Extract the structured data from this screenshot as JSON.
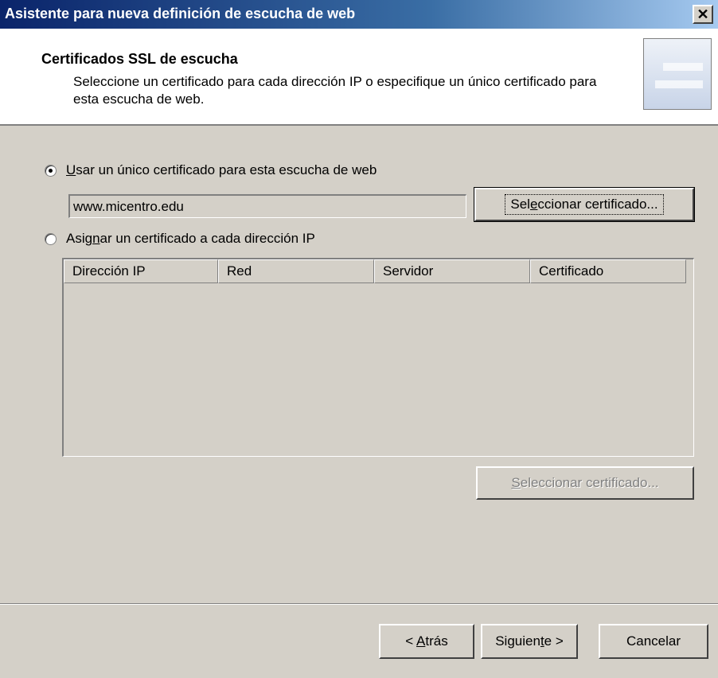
{
  "window": {
    "title": "Asistente para nueva definición de escucha de web"
  },
  "header": {
    "title": "Certificados SSL de escucha",
    "description": "Seleccione un certificado para cada dirección IP o especifique un único certificado para esta escucha de web."
  },
  "options": {
    "single": {
      "label_prefix": "U",
      "label_rest": "sar un único certificado para esta escucha de web",
      "selected": true
    },
    "per_ip": {
      "label_a": "Asig",
      "label_u": "n",
      "label_b": "ar un certificado a cada dirección IP",
      "selected": false
    }
  },
  "certificate_field": {
    "value": "www.micentro.edu"
  },
  "buttons": {
    "select_cert_a": "Sel",
    "select_cert_u": "e",
    "select_cert_b": "ccionar certificado...",
    "select_cert2_u": "S",
    "select_cert2_b": "eleccionar certificado...",
    "back_a": "< ",
    "back_u": "A",
    "back_b": "trás",
    "next_a": "Siguien",
    "next_u": "t",
    "next_b": "e >",
    "cancel": "Cancelar"
  },
  "table": {
    "columns": [
      "Dirección IP",
      "Red",
      "Servidor",
      "Certificado"
    ],
    "rows": []
  },
  "colors": {
    "title_start": "#0a246a",
    "title_end": "#a6caf0",
    "face": "#d4d0c8"
  }
}
